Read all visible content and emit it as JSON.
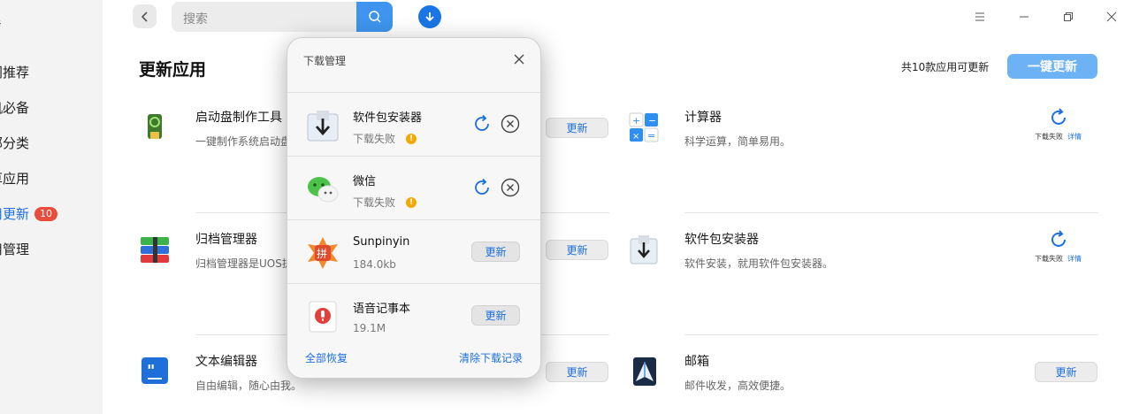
{
  "sidebar": {
    "heading": "發",
    "items": [
      {
        "label": "门推荐",
        "active": false
      },
      {
        "label": "机必备",
        "active": false
      },
      {
        "label": "部分类",
        "active": false
      },
      {
        "label": "草应用",
        "active": false
      },
      {
        "label": "用更新",
        "active": true,
        "badge": "10"
      },
      {
        "label": "用管理",
        "active": false
      }
    ]
  },
  "topbar": {
    "search_placeholder": "搜索",
    "icons": [
      "back-icon",
      "search-icon",
      "download-icon",
      "menu-icon",
      "minimize-icon",
      "restore-icon",
      "close-icon"
    ]
  },
  "main": {
    "title": "更新应用",
    "total_text": "共10款应用可更新",
    "update_all_label": "一键更新",
    "update_label": "更新"
  },
  "apps": [
    {
      "name": "启动盘制作工具",
      "desc": "一键制作系统启动盘",
      "icon": "usb-drive-icon"
    },
    {
      "name": "计算器",
      "desc": "科学运算，简单易用。",
      "icon": "calculator-icon",
      "status": "下载失败",
      "detail": "详情"
    },
    {
      "name": "归档管理器",
      "desc": "归档管理器是UOS提",
      "icon": "archive-icon"
    },
    {
      "name": "软件包安装器",
      "desc": "软件安装，就用软件包安装器。",
      "icon": "package-installer-icon",
      "status": "下载失败",
      "detail": "详情"
    },
    {
      "name": "文本编辑器",
      "desc": "自由编辑，随心由我。",
      "icon": "text-editor-icon"
    },
    {
      "name": "邮箱",
      "desc": "邮件收发，高效便捷。",
      "icon": "mail-icon"
    }
  ],
  "download_manager": {
    "title": "下载管理",
    "items": [
      {
        "name": "软件包安装器",
        "sub": "下载失败",
        "state": "failed",
        "icon": "package-installer-icon"
      },
      {
        "name": "微信",
        "sub": "下载失败",
        "state": "failed",
        "icon": "wechat-icon"
      },
      {
        "name": "Sunpinyin",
        "sub": "184.0kb",
        "state": "update",
        "icon": "sunpinyin-icon"
      },
      {
        "name": "语音记事本",
        "sub": "19.1M",
        "state": "update",
        "icon": "voice-notes-icon"
      }
    ],
    "update_label": "更新",
    "resume_all": "全部恢复",
    "clear_records": "清除下载记录"
  },
  "colors": {
    "accent": "#1c6fe0",
    "update_all_bg": "#6cb2f5",
    "badge": "#e84c3d",
    "warning": "#f2a900"
  }
}
